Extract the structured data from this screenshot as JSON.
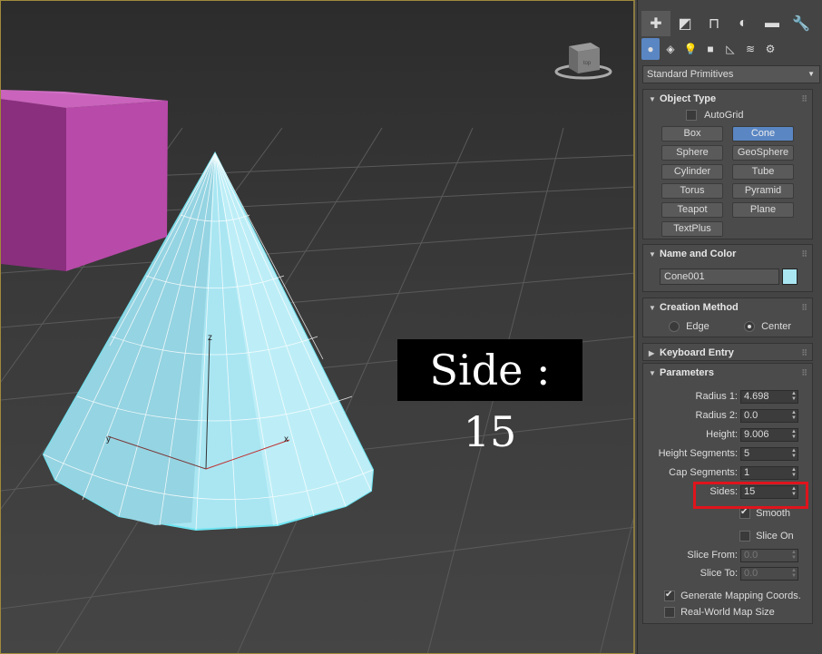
{
  "overlay": {
    "side_text": "Side : 15"
  },
  "viewport": {
    "axis_x": "x",
    "axis_y": "y",
    "axis_z": "z",
    "viewcube_label": "top"
  },
  "panel": {
    "tabs": [
      "create-icon",
      "modify-icon",
      "hierarchy-icon",
      "motion-icon",
      "display-icon",
      "utilities-icon"
    ],
    "category_icons": [
      "geometry-icon",
      "shapes-icon",
      "lights-icon",
      "cameras-icon",
      "helpers-icon",
      "spacewarps-icon",
      "systems-icon"
    ],
    "dropdown": "Standard Primitives",
    "object_type": {
      "title": "Object Type",
      "autogrid": "AutoGrid",
      "buttons": [
        "Box",
        "Cone",
        "Sphere",
        "GeoSphere",
        "Cylinder",
        "Tube",
        "Torus",
        "Pyramid",
        "Teapot",
        "Plane",
        "TextPlus"
      ],
      "active": "Cone"
    },
    "name_color": {
      "title": "Name and Color",
      "name": "Cone001",
      "color": "#a9e6f2"
    },
    "creation_method": {
      "title": "Creation Method",
      "edge": "Edge",
      "center": "Center"
    },
    "keyboard_entry": {
      "title": "Keyboard Entry"
    },
    "parameters": {
      "title": "Parameters",
      "radius1_label": "Radius 1:",
      "radius1": "4.698",
      "radius2_label": "Radius 2:",
      "radius2": "0.0",
      "height_label": "Height:",
      "height": "9.006",
      "height_segments_label": "Height Segments:",
      "height_segments": "5",
      "cap_segments_label": "Cap Segments:",
      "cap_segments": "1",
      "sides_label": "Sides:",
      "sides": "15",
      "smooth_label": "Smooth",
      "slice_on_label": "Slice On",
      "slice_from_label": "Slice From:",
      "slice_from": "0.0",
      "slice_to_label": "Slice To:",
      "slice_to": "0.0",
      "gen_mapping_label": "Generate Mapping Coords.",
      "real_world_label": "Real-World Map Size"
    }
  },
  "colors": {
    "accent": "#5a86c3",
    "highlight": "#e0141c",
    "box": "#b84aa9",
    "cone": "#a9e6f2"
  }
}
